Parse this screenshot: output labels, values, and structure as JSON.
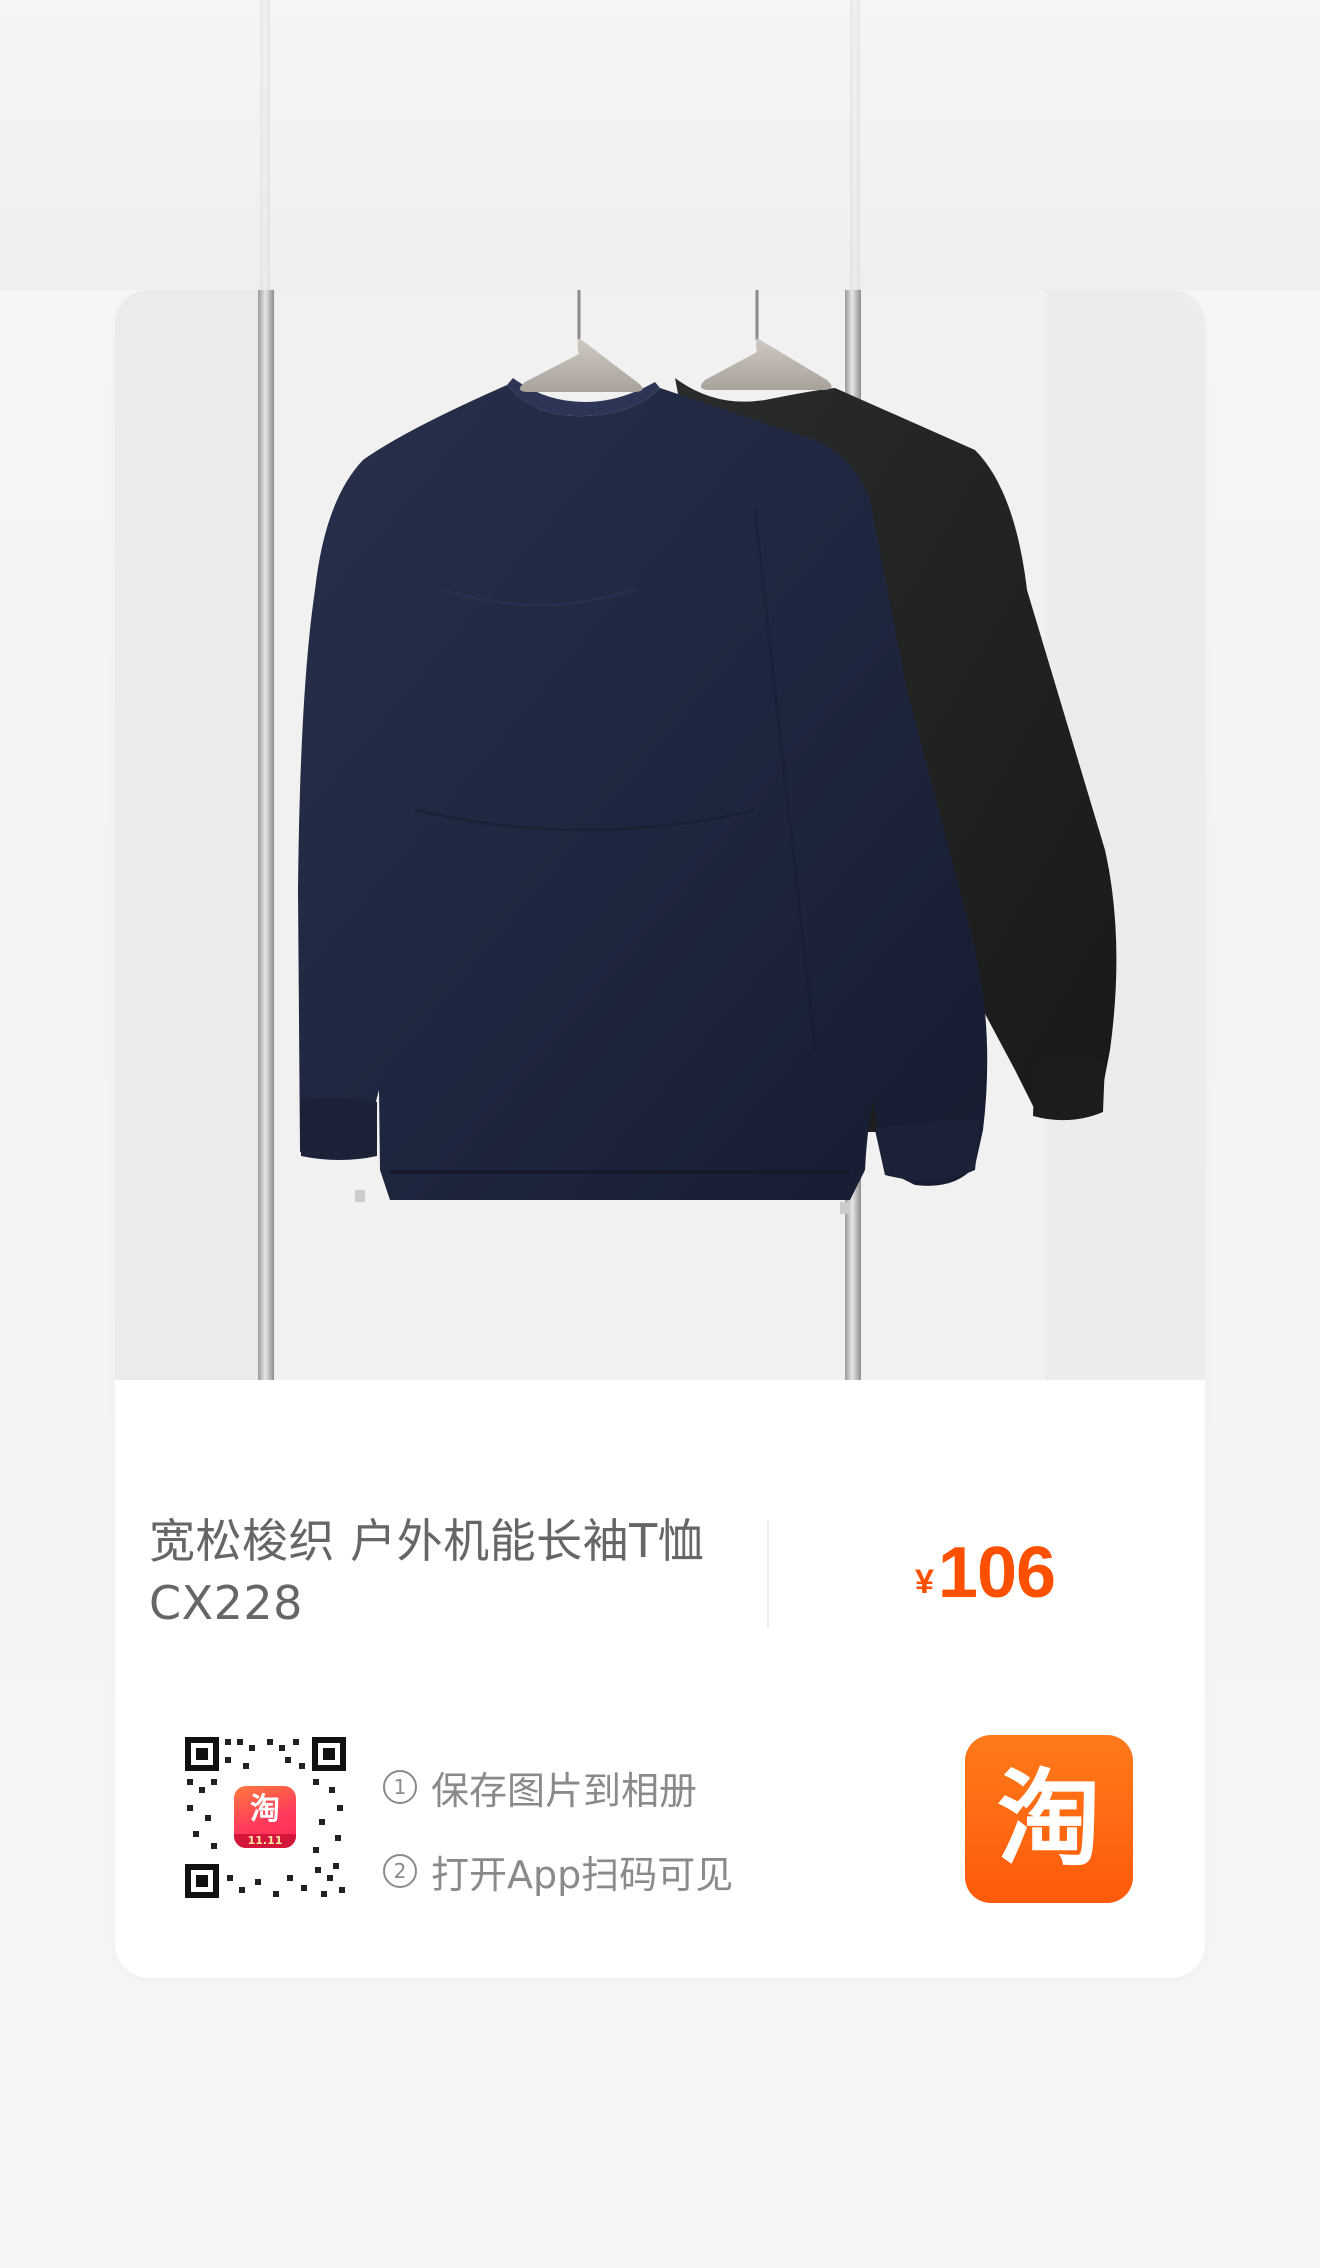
{
  "product": {
    "title_line1": "宽松梭织 户外机能长袖T恤",
    "title_line2": "CX228",
    "price_currency": "¥",
    "price_amount": "106"
  },
  "qr_section": {
    "qr_logo_text": "淘",
    "qr_logo_badge": "11.11",
    "steps": [
      {
        "number": "1",
        "label": "保存图片到相册"
      },
      {
        "number": "2",
        "label": "打开App扫码可见"
      }
    ]
  },
  "app_logo": {
    "icon": "taobao-logo-icon",
    "text": "淘"
  },
  "colors": {
    "price": "#ff5000",
    "taobao_orange": "#ff5a0a",
    "title_text": "#666666",
    "step_text": "#8a8a8a"
  },
  "photo": {
    "icon": "product-photo-two-sweatshirts"
  }
}
